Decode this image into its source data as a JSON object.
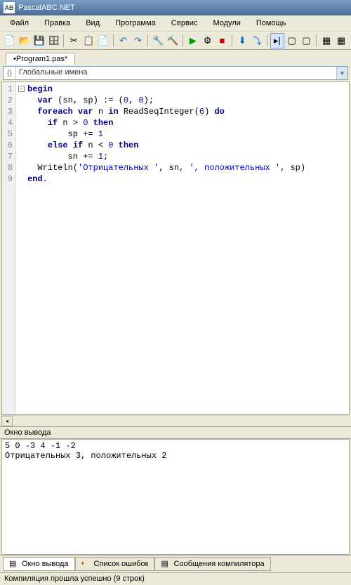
{
  "title": "PascalABC.NET",
  "menu": [
    "Файл",
    "Правка",
    "Вид",
    "Программа",
    "Сервис",
    "Модули",
    "Помощь"
  ],
  "tab": "•Program1.pas*",
  "dropdown": "Глобальные имена",
  "gutter": [
    "1",
    "2",
    "3",
    "4",
    "5",
    "6",
    "7",
    "8",
    "9"
  ],
  "code": {
    "l1_begin": "begin",
    "l2_var": "var",
    "l2_rest": " (sn, sp) := (",
    "l2_n0a": "0",
    "l2_mid": ", ",
    "l2_n0b": "0",
    "l2_end": ");",
    "l3_foreach": "foreach",
    "l3_var": "var",
    "l3_mid": " n ",
    "l3_in": "in",
    "l3_call": " ReadSeqInteger(",
    "l3_n6": "6",
    "l3_do": "do",
    "l3_close": ") ",
    "l4_if": "if",
    "l4_mid": " n > ",
    "l4_n0": "0",
    "l4_then": "then",
    "l5": "        sp += ",
    "l5_n1": "1",
    "l6_else": "else",
    "l6_if": "if",
    "l6_mid": " n < ",
    "l6_n0": "0",
    "l6_then": "then",
    "l7": "        sn += ",
    "l7_n1": "1",
    "l7_semi": ";",
    "l8a": "  Writeln(",
    "l8s1": "'Отрицательных '",
    "l8m1": ", sn, ",
    "l8s2": "', положительных '",
    "l8m2": ", sp)",
    "l9_end": "end",
    "l9_dot": "."
  },
  "outputPanelTitle": "Окно вывода",
  "output": "5 0 -3 4 -1 -2\nОтрицательных 3, положительных 2",
  "bottomTabs": [
    "Окно вывода",
    "Список ошибок",
    "Сообщения компилятора"
  ],
  "status": "Компиляция прошла успешно (9 строк)"
}
